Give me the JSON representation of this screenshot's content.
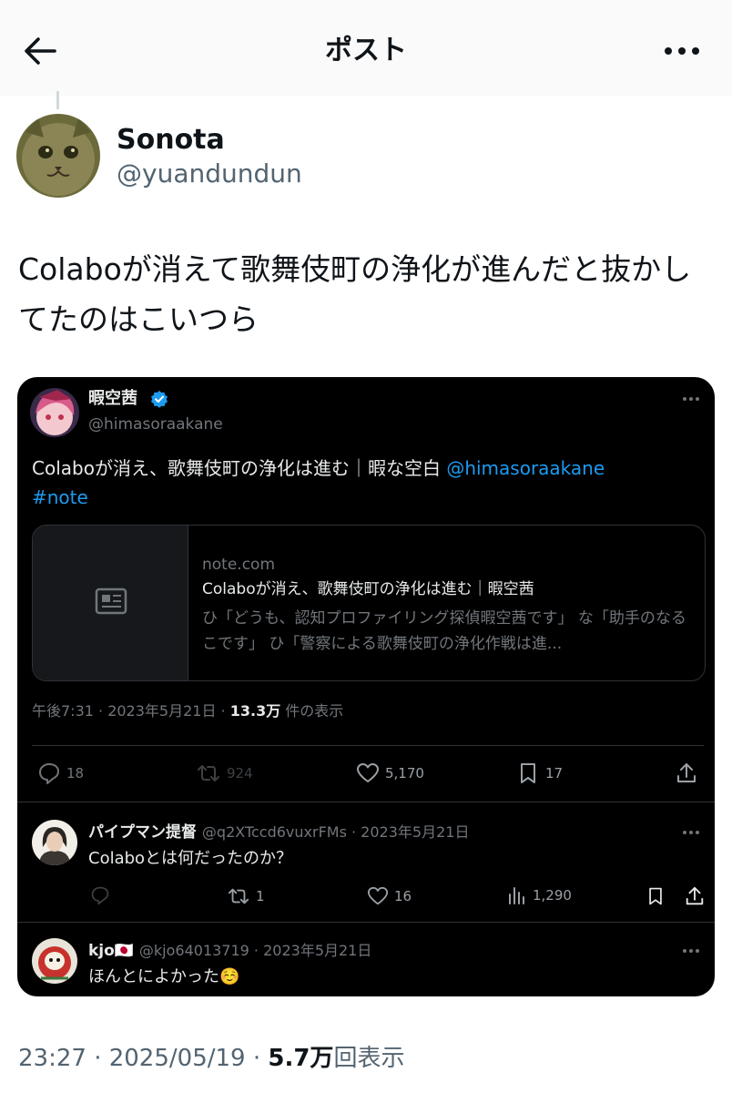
{
  "header": {
    "title": "ポスト",
    "back_icon": "arrow-left-icon",
    "more_icon": "more-horizontal-icon"
  },
  "post": {
    "author_name": "Sonota",
    "author_handle": "@yuandundun",
    "text": "Colaboが消えて歌舞伎町の浄化が進んだと抜かしてたのはこいつら",
    "time": "23:27 · 2025/05/19 · ",
    "views_count": "5.7万",
    "views_label": "回表示"
  },
  "quoted": {
    "author_name": "暇空茜",
    "author_handle": "@himasoraakane",
    "verified_icon": "verified-badge-icon",
    "text_main": "Colaboが消え、歌舞伎町の浄化は進む｜暇な空白 ",
    "mention": "@himasoraakane",
    "hashtag": "#note",
    "card": {
      "domain": "note.com",
      "title": "Colaboが消え、歌舞伎町の浄化は進む｜暇空茜",
      "description": "ひ「どうも、認知プロファイリング探偵暇空茜です」 な「助手のなるこです」 ひ「警察による歌舞伎町の浄化作戦は進..."
    },
    "meta_time": "午後7:31 · 2023年5月21日 · ",
    "meta_views": "13.3万",
    "meta_views_label": " 件の表示",
    "actions": {
      "replies": "18",
      "reposts": "924",
      "likes": "5,170",
      "bookmarks": "17"
    }
  },
  "replies": [
    {
      "name": "パイプマン提督",
      "meta": "@q2XTccd6vuxrFMs · 2023年5月21日",
      "text": "Colaboとは何だったのか？",
      "actions": {
        "reposts": "1",
        "likes": "16",
        "views": "1,290"
      }
    },
    {
      "name": "kjo",
      "flag": "🇯🇵",
      "meta": "@kjo64013719 · 2023年5月21日",
      "text": "ほんとによかった",
      "emoji": "☺️"
    }
  ],
  "colors": {
    "accent": "#1d9bf0",
    "dark_bg": "#000000",
    "muted": "#71767b"
  }
}
